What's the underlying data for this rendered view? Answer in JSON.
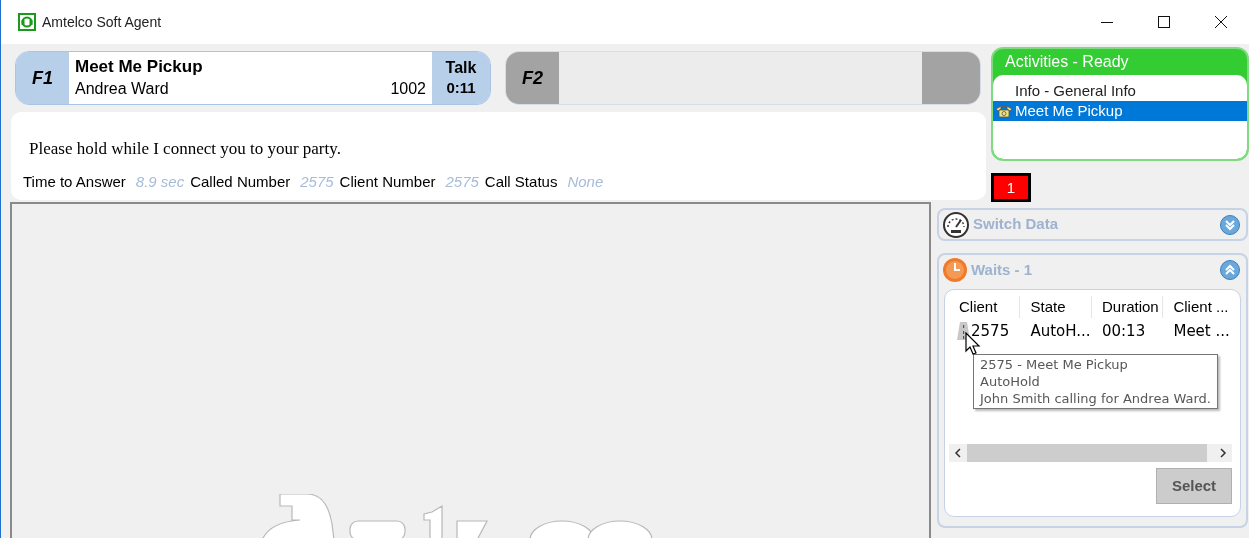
{
  "window": {
    "title": "Amtelco Soft Agent"
  },
  "call_lines": [
    {
      "key": "F1",
      "active": true,
      "title": "Meet Me Pickup",
      "name": "Andrea Ward",
      "extension": "1002",
      "state": "Talk",
      "timer": "0:11"
    },
    {
      "key": "F2",
      "active": false
    }
  ],
  "message": "Please hold while I connect you to your party.",
  "call_info": [
    {
      "label": "Time to Answer",
      "value": "8.9 sec"
    },
    {
      "label": "Called Number",
      "value": "2575"
    },
    {
      "label": "Client Number",
      "value": "2575"
    },
    {
      "label": "Call Status",
      "value": "None"
    }
  ],
  "activities": {
    "title": "Activities - Ready",
    "items": [
      {
        "label": "Info - General Info",
        "kind": "plain",
        "selected": false
      },
      {
        "label": "Meet Me Pickup",
        "kind": "phone",
        "selected": true
      }
    ]
  },
  "badge": "1",
  "switch_data": {
    "title": "Switch Data",
    "expanded": false
  },
  "waits": {
    "title": "Waits - 1",
    "expanded": true,
    "columns": [
      "Client",
      "State",
      "Duration",
      "Client ..."
    ],
    "rows": [
      {
        "cells": [
          "2575",
          "AutoH...",
          "00:13",
          "Meet ..."
        ]
      }
    ],
    "tooltip": [
      "2575 - Meet Me Pickup",
      "AutoHold",
      "John Smith calling for Andrea Ward."
    ],
    "button": "Select"
  }
}
